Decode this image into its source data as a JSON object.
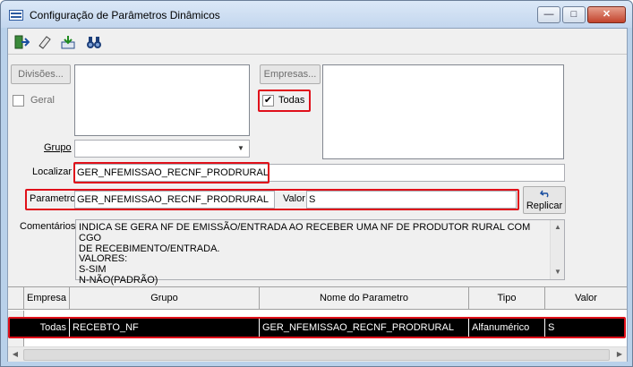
{
  "window": {
    "title": "Configuração de Parâmetros Dinâmicos",
    "controls": {
      "minimize": "—",
      "maximize": "□",
      "close": "✕"
    }
  },
  "toolbar": {
    "icons": [
      "exit-icon",
      "eraser-icon",
      "save-icon",
      "binoculars-icon"
    ]
  },
  "divisoes_button": "Divisões...",
  "geral_label": "Geral",
  "empresas_button": "Empresas...",
  "todas_label": "Todas",
  "todas_checked": "✔",
  "grupo_label": "Grupo",
  "grupo_dropdown_arrow": "▼",
  "localizar_label": "Localizar",
  "localizar_value": "GER_NFEMISSAO_RECNF_PRODRURAL",
  "parametro_label": "Parametro",
  "parametro_value": "GER_NFEMISSAO_RECNF_PRODRURAL",
  "valor_label": "Valor",
  "valor_value": "S",
  "replicar_label": "Replicar",
  "comentarios_label": "Comentários",
  "comentarios_lines": [
    "INDICA SE GERA NF DE EMISSÃO/ENTRADA AO RECEBER UMA NF DE PRODUTOR RURAL COM CGO",
    "DE RECEBIMENTO/ENTRADA.",
    "VALORES:",
    "S-SIM",
    "N-NÃO(PADRÃO)"
  ],
  "grid": {
    "columns": [
      "Empresa",
      "Grupo",
      "Nome do Parametro",
      "Tipo",
      "Valor"
    ],
    "rows": [
      {
        "empresa": "Todas",
        "grupo": "RECEBTO_NF",
        "nome": "GER_NFEMISSAO_RECNF_PRODRURAL",
        "tipo": "Alfanumérico",
        "valor": "S"
      }
    ]
  },
  "colors": {
    "highlight": "#e0101a",
    "selected_row": "#000000"
  }
}
